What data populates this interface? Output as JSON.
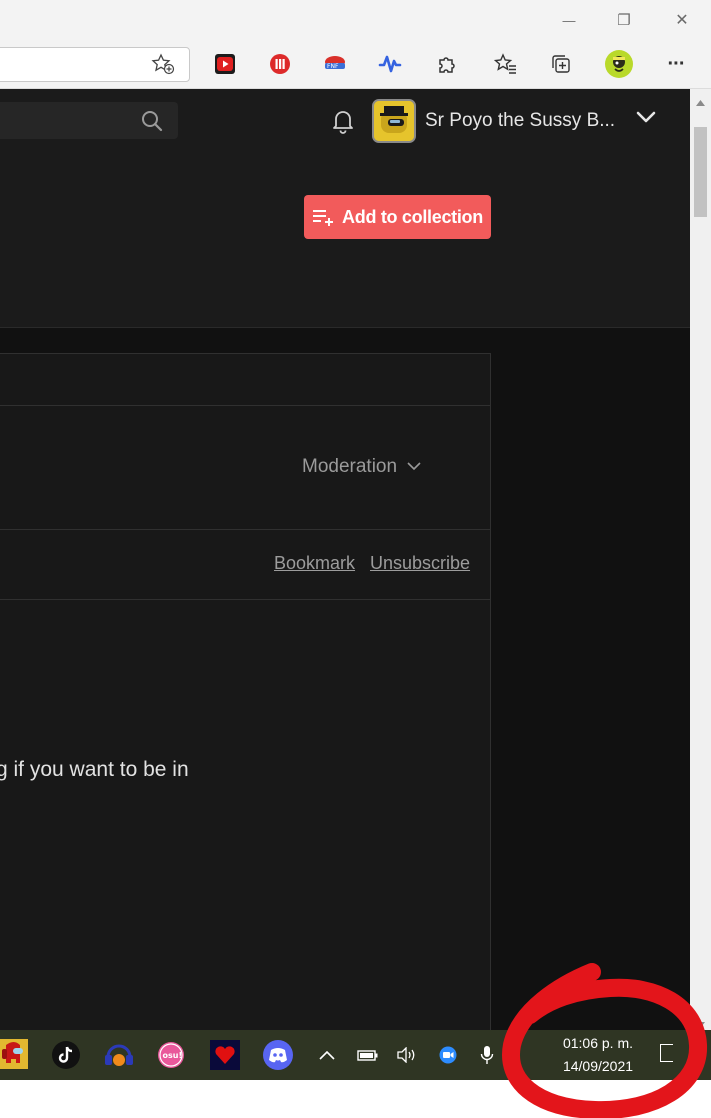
{
  "window": {
    "minimize_glyph": "—",
    "restore_glyph": "❐",
    "close_glyph": "✕"
  },
  "toolbar": {
    "icons": [
      "add-favorite-icon",
      "youtube-extension-icon",
      "red-circle-extension-icon",
      "fnf-extension-icon",
      "audio-wave-extension-icon",
      "extensions-puzzle-icon",
      "favorites-icon",
      "collections-icon",
      "profile-avatar-icon",
      "more-menu-icon"
    ],
    "more_glyph": "···"
  },
  "header": {
    "username": "Sr Poyo the Sussy B...",
    "chevron_glyph": "⌄",
    "add_collection_label": "Add to collection"
  },
  "content": {
    "moderation_label": "Moderation",
    "bookmark_label": "Bookmark",
    "unsubscribe_label": "Unsubscribe",
    "post_text": "g if you want to be in"
  },
  "taskbar": {
    "apps": [
      "among-us-icon",
      "tiktok-icon",
      "audio-app-icon",
      "osu-icon",
      "undertale-heart-icon",
      "discord-icon"
    ],
    "osu_label": "osu!",
    "tray_icons": [
      "show-hidden-icons-chevron",
      "battery-icon",
      "volume-icon",
      "zoom-icon",
      "microphone-icon"
    ],
    "clock_time": "01:06 p. m.",
    "clock_date": "14/09/2021"
  },
  "colors": {
    "accent_button": "#f25b5b",
    "page_background": "#111111",
    "header_background": "#1b1b1b",
    "taskbar": "#2f3523",
    "annotation_circle": "#e3151b"
  }
}
